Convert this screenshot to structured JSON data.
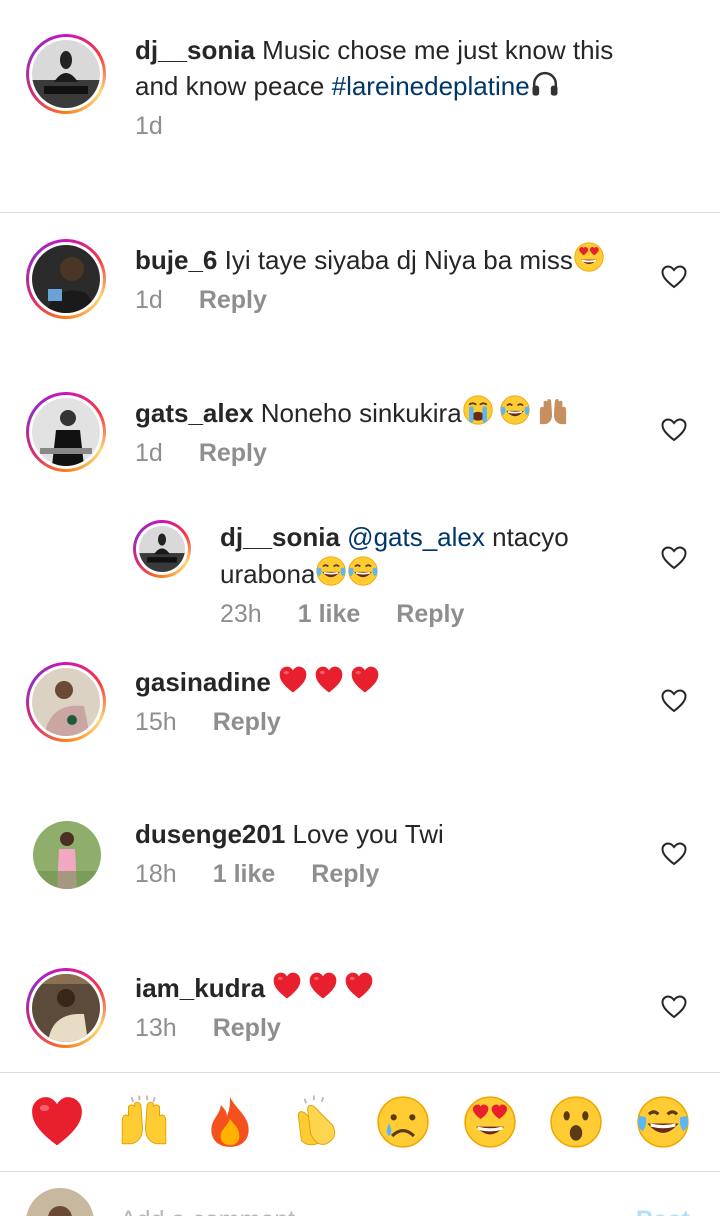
{
  "caption": {
    "username": "dj__sonia",
    "text": "Music chose me just know this and know peace",
    "hashtag": "#lareinedeplatine",
    "time": "1d"
  },
  "comments": [
    {
      "username": "buje_6",
      "text": "Iyi taye siyaba dj Niya ba miss",
      "time": "1d",
      "likes": "",
      "reply_label": "Reply"
    },
    {
      "username": "gats_alex",
      "text": "Noneho sinkukira",
      "time": "1d",
      "likes": "",
      "reply_label": "Reply"
    },
    {
      "username": "dj__sonia",
      "mention": "@gats_alex",
      "text": "ntacyo urabona",
      "time": "23h",
      "likes": "1 like",
      "reply_label": "Reply"
    },
    {
      "username": "gasinadine",
      "text": "",
      "time": "15h",
      "likes": "",
      "reply_label": "Reply"
    },
    {
      "username": "dusenge201",
      "text": "Love you Twi",
      "time": "18h",
      "likes": "1 like",
      "reply_label": "Reply"
    },
    {
      "username": "iam_kudra",
      "text": "",
      "time": "13h",
      "likes": "",
      "reply_label": "Reply"
    }
  ],
  "reactions": [
    "red-heart",
    "raising-hands",
    "fire",
    "clapping-hands",
    "sad-face",
    "heart-eyes",
    "surprised-face",
    "tears-of-joy"
  ],
  "composer": {
    "placeholder": "Add a comment...",
    "post_label": "Post"
  },
  "colors": {
    "link": "#00376b",
    "meta": "#8e8e8e",
    "divider": "#dbdbdb"
  }
}
